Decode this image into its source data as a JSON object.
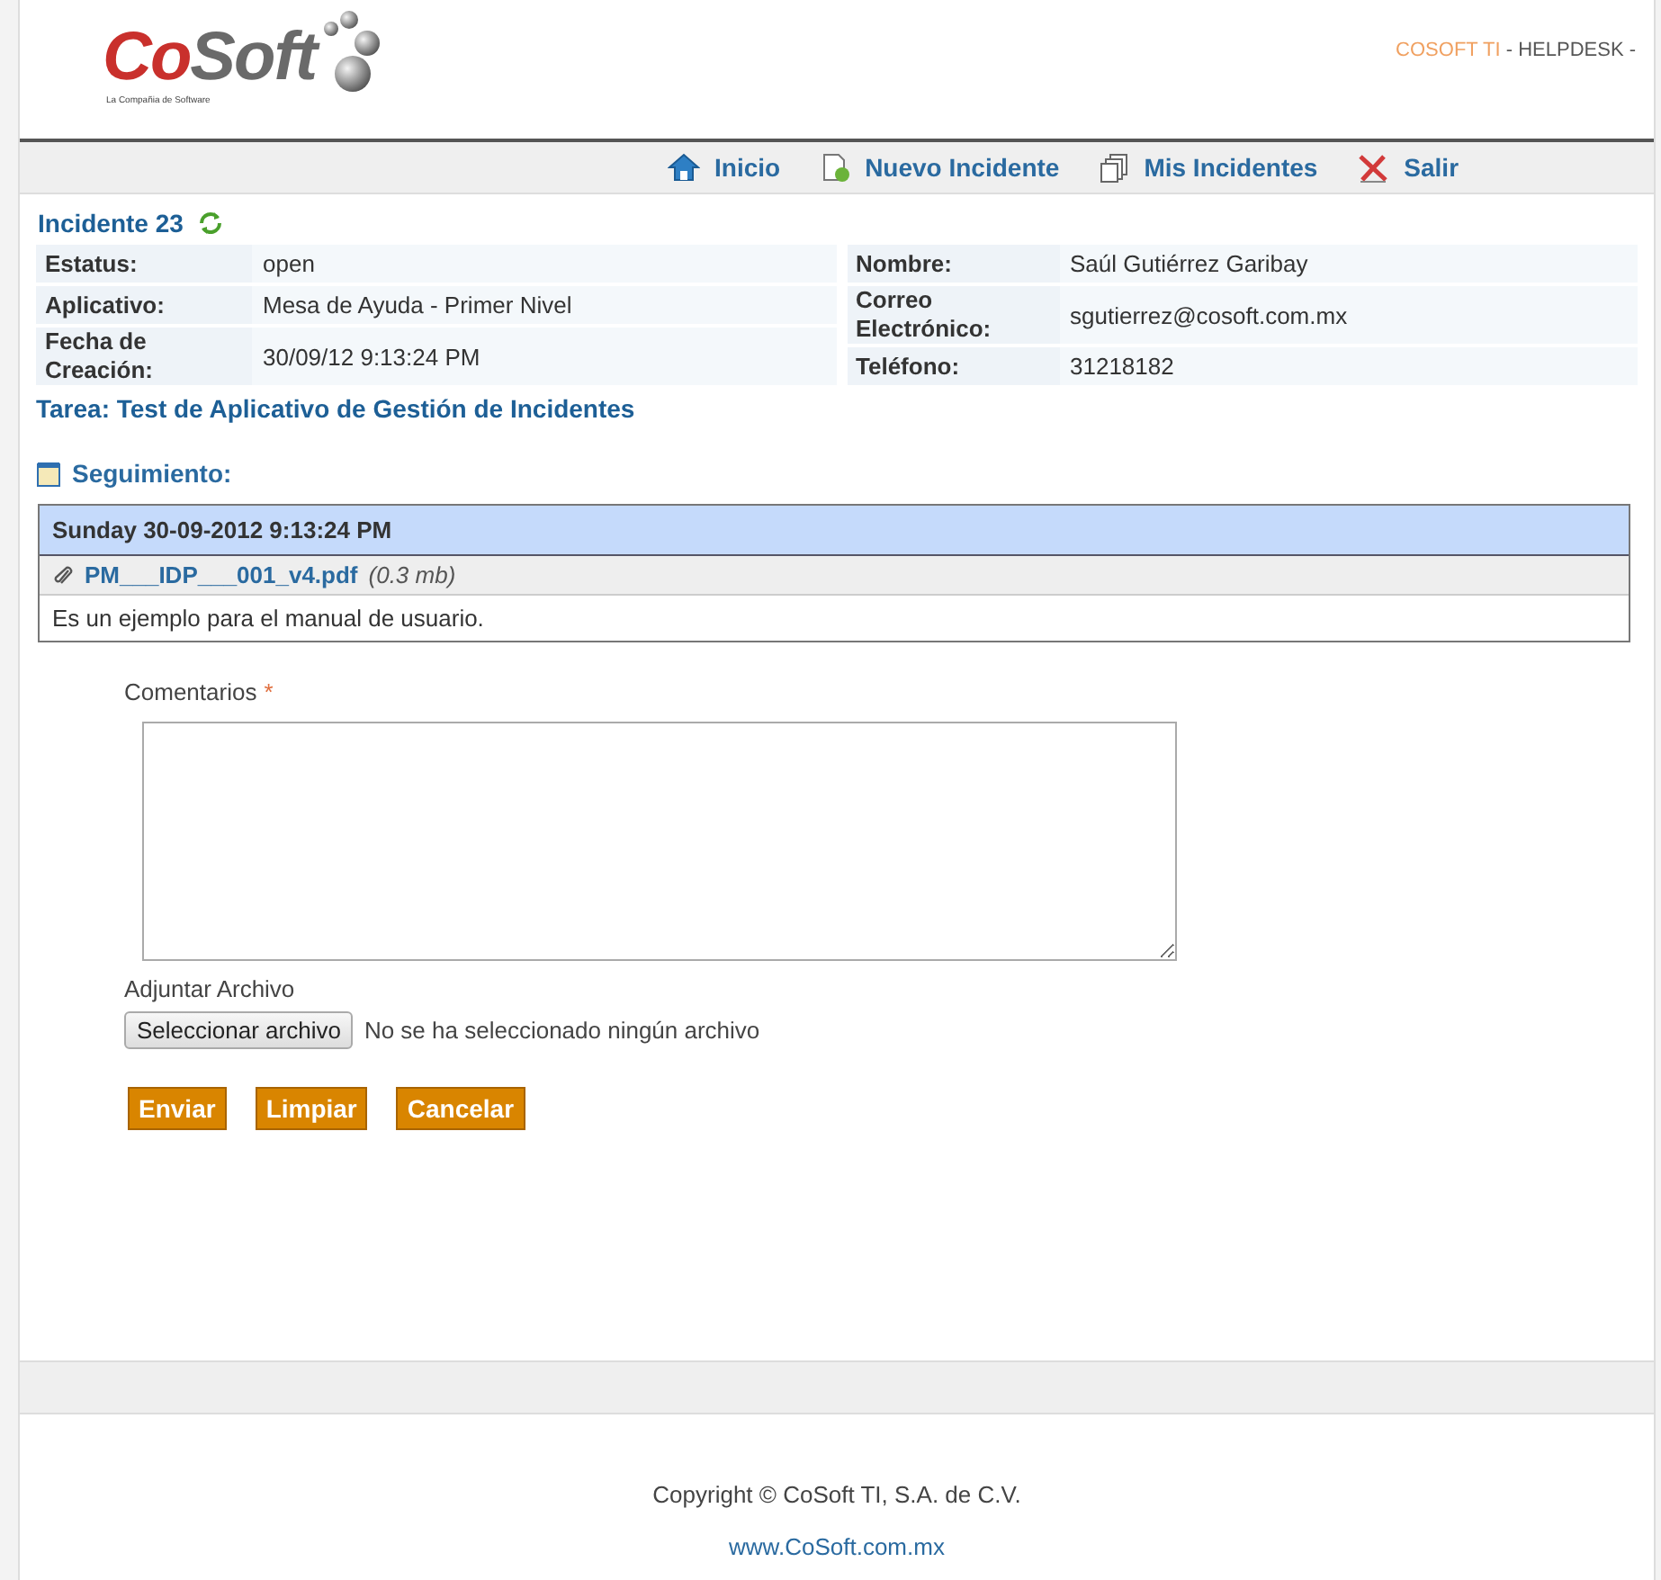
{
  "header": {
    "logo_first": "Co",
    "logo_rest": "Soft",
    "logo_tagline": "La Compañia de Software",
    "company": "COSOFT TI",
    "product": " - HELPDESK -"
  },
  "nav": [
    {
      "kind": "home",
      "label": "Inicio"
    },
    {
      "kind": "new",
      "label": "Nuevo Incidente"
    },
    {
      "kind": "list",
      "label": "Mis Incidentes"
    },
    {
      "kind": "exit",
      "label": "Salir"
    }
  ],
  "incident": {
    "title": "Incidente 23",
    "left": [
      {
        "label": "Estatus:",
        "value": "open"
      },
      {
        "label": "Aplicativo:",
        "value": "Mesa de Ayuda - Primer Nivel"
      },
      {
        "label": "Fecha de Creación:",
        "value": "30/09/12 9:13:24 PM"
      }
    ],
    "right": [
      {
        "label": "Nombre:",
        "value": "Saúl Gutiérrez Garibay"
      },
      {
        "label": "Correo Electrónico:",
        "value": "sgutierrez@cosoft.com.mx"
      },
      {
        "label": "Teléfono:",
        "value": "31218182"
      }
    ],
    "task": "Tarea: Test de Aplicativo de Gestión de Incidentes"
  },
  "followup": {
    "title": "Seguimiento:",
    "date": "Sunday 30-09-2012 9:13:24 PM",
    "file": "PM___IDP___001_v4.pdf",
    "file_size": "(0.3 mb)",
    "message": "Es un ejemplo para el manual de usuario."
  },
  "form": {
    "comments_label": "Comentarios",
    "required_mark": "*",
    "attach_label": "Adjuntar Archivo",
    "file_button": "Seleccionar archivo",
    "file_status": "No se ha seleccionado ningún archivo",
    "buttons": [
      "Enviar",
      "Limpiar",
      "Cancelar"
    ]
  },
  "footer": {
    "copyright": "Copyright © CoSoft TI, S.A. de C.V.",
    "link": "www.CoSoft.com.mx"
  }
}
